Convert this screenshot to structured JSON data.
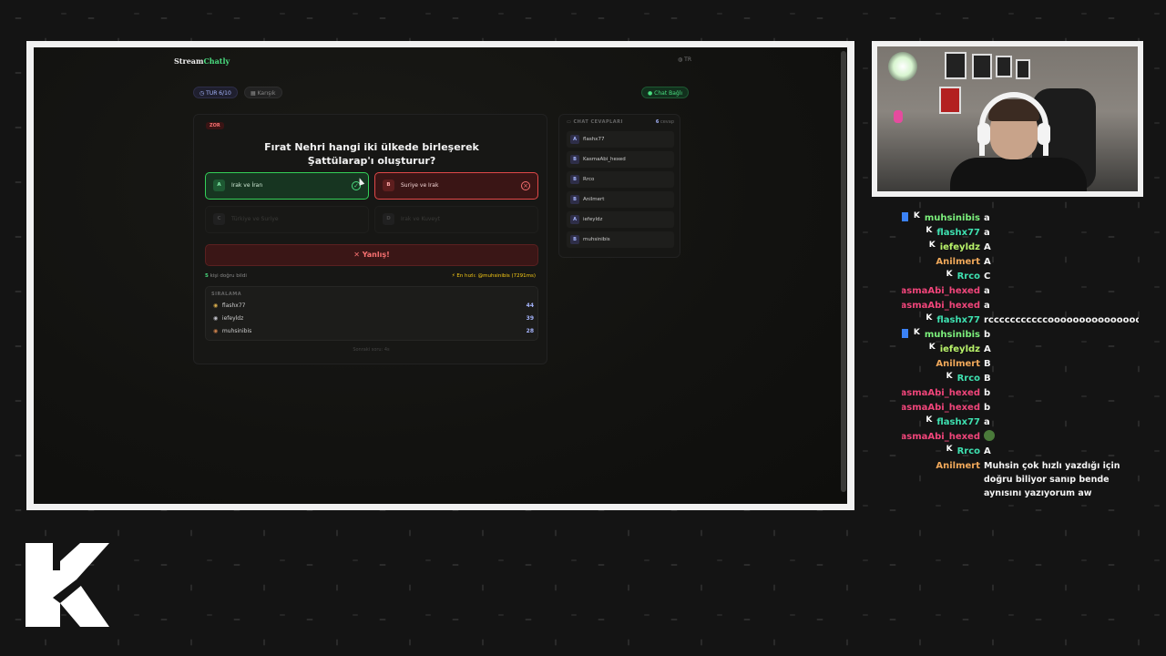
{
  "app": {
    "brand_first": "Stream",
    "brand_second": "Chatly",
    "language": "TR",
    "round": "TUR 6/10",
    "category": "Karışık",
    "chat_status": "Chat Bağlı"
  },
  "question": {
    "difficulty": "ZOR",
    "text": "Fırat Nehri hangi iki ülkede birleşerek Şattülarap'ı oluşturur?",
    "options": [
      {
        "letter": "A",
        "label": "Irak ve İran",
        "state": "correct"
      },
      {
        "letter": "B",
        "label": "Suriye ve Irak",
        "state": "wrong"
      },
      {
        "letter": "C",
        "label": "Türkiye ve Suriye",
        "state": "disabled"
      },
      {
        "letter": "D",
        "label": "Irak ve Kuveyt",
        "state": "disabled"
      }
    ],
    "result_label": "Yanlış!",
    "correct_count": "5",
    "correct_suffix": " kişi doğru bildi",
    "fastest": "En hızlı: @muhsinibis (7291ms)"
  },
  "ranking": {
    "title": "SIRALAMA",
    "rows": [
      {
        "name": "flashx77",
        "score": "44"
      },
      {
        "name": "iefeyldz",
        "score": "39"
      },
      {
        "name": "muhsinibis",
        "score": "28"
      }
    ],
    "next_label": "Sonraki soru: 4s"
  },
  "chat_answers": {
    "title": "CHAT CEVAPLARI",
    "count": "6",
    "count_suffix": " cevap",
    "rows": [
      {
        "letter": "A",
        "name": "flashx77"
      },
      {
        "letter": "B",
        "name": "KasmaAbi_hexed"
      },
      {
        "letter": "B",
        "name": "Rrco"
      },
      {
        "letter": "B",
        "name": "Anilmert"
      },
      {
        "letter": "A",
        "name": "iefeyldz"
      },
      {
        "letter": "B",
        "name": "muhsinibis"
      }
    ]
  },
  "stream_chat": {
    "messages": [
      {
        "name": "muhsinibis",
        "text": "a",
        "color": "#7cf07c",
        "badge": true,
        "blue": true
      },
      {
        "name": "flashx77",
        "text": "a",
        "color": "#3ee0b0",
        "badge": true
      },
      {
        "name": "iefeyldz",
        "text": "A",
        "color": "#b9f36a",
        "badge": true
      },
      {
        "name": "Anilmert",
        "text": "A",
        "color": "#f0a85a",
        "badge": false
      },
      {
        "name": "Rrco",
        "text": "C",
        "color": "#3ee0b0",
        "badge": true
      },
      {
        "name": "KasmaAbi_hexed",
        "text": "a",
        "color": "#f0457a",
        "badge": true
      },
      {
        "name": "KasmaAbi_hexed",
        "text": "a",
        "color": "#f0457a",
        "badge": true
      },
      {
        "name": "flashx77",
        "text": "rcccccccccccooooooooooooooo",
        "color": "#3ee0b0",
        "badge": true
      },
      {
        "name": "muhsinibis",
        "text": "b",
        "color": "#7cf07c",
        "badge": true,
        "blue": true
      },
      {
        "name": "iefeyldz",
        "text": "A",
        "color": "#b9f36a",
        "badge": true
      },
      {
        "name": "Anilmert",
        "text": "B",
        "color": "#f0a85a",
        "badge": false
      },
      {
        "name": "Rrco",
        "text": "B",
        "color": "#3ee0b0",
        "badge": true
      },
      {
        "name": "KasmaAbi_hexed",
        "text": "b",
        "color": "#f0457a",
        "badge": true
      },
      {
        "name": "KasmaAbi_hexed",
        "text": "b",
        "color": "#f0457a",
        "badge": true
      },
      {
        "name": "flashx77",
        "text": "a",
        "color": "#3ee0b0",
        "badge": true
      },
      {
        "name": "KasmaAbi_hexed",
        "text": "",
        "color": "#f0457a",
        "badge": true,
        "emote": true
      },
      {
        "name": "Rrco",
        "text": "A",
        "color": "#3ee0b0",
        "badge": true
      }
    ],
    "last": {
      "name": "Anilmert",
      "color": "#f0a85a",
      "text": "Muhsin çok hızlı yazdığı için doğru biliyor sanıp bende aynısını yazıyorum aw"
    }
  }
}
